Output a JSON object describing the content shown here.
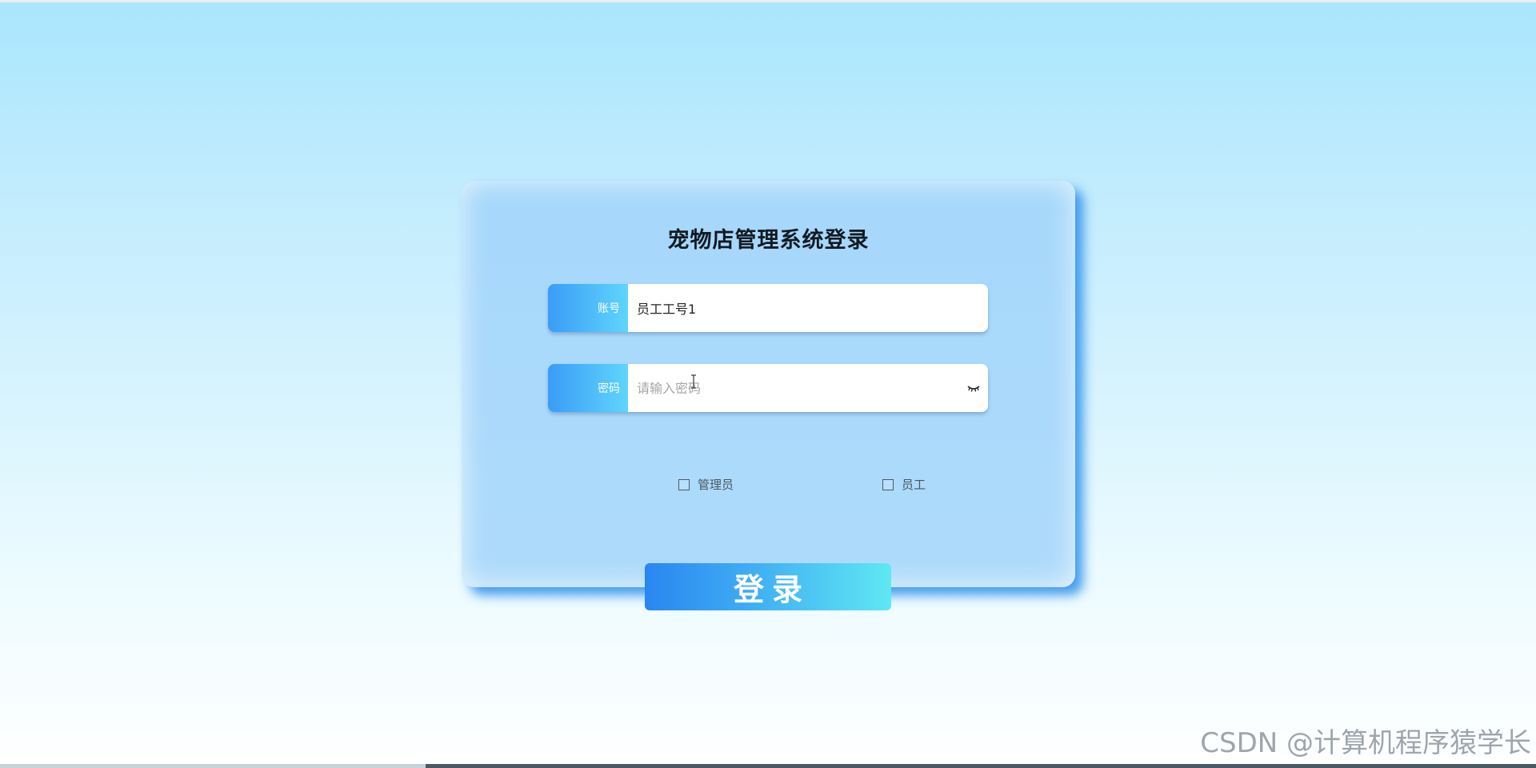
{
  "login": {
    "title": "宠物店管理系统登录",
    "username": {
      "label": "账号",
      "value": "员工工号1",
      "placeholder": ""
    },
    "password": {
      "label": "密码",
      "value": "",
      "placeholder": "请输入密码",
      "toggle_icon": "eye-closed-icon"
    },
    "roles": [
      {
        "label": "管理员",
        "checked": false
      },
      {
        "label": "员工",
        "checked": false
      }
    ],
    "submit_label": "登录"
  },
  "watermark": "CSDN @计算机程序猿学长",
  "colors": {
    "accent_gradient_start": "#2a86f0",
    "accent_gradient_end": "#5fe8f3",
    "card_shadow": "#288ceb"
  }
}
